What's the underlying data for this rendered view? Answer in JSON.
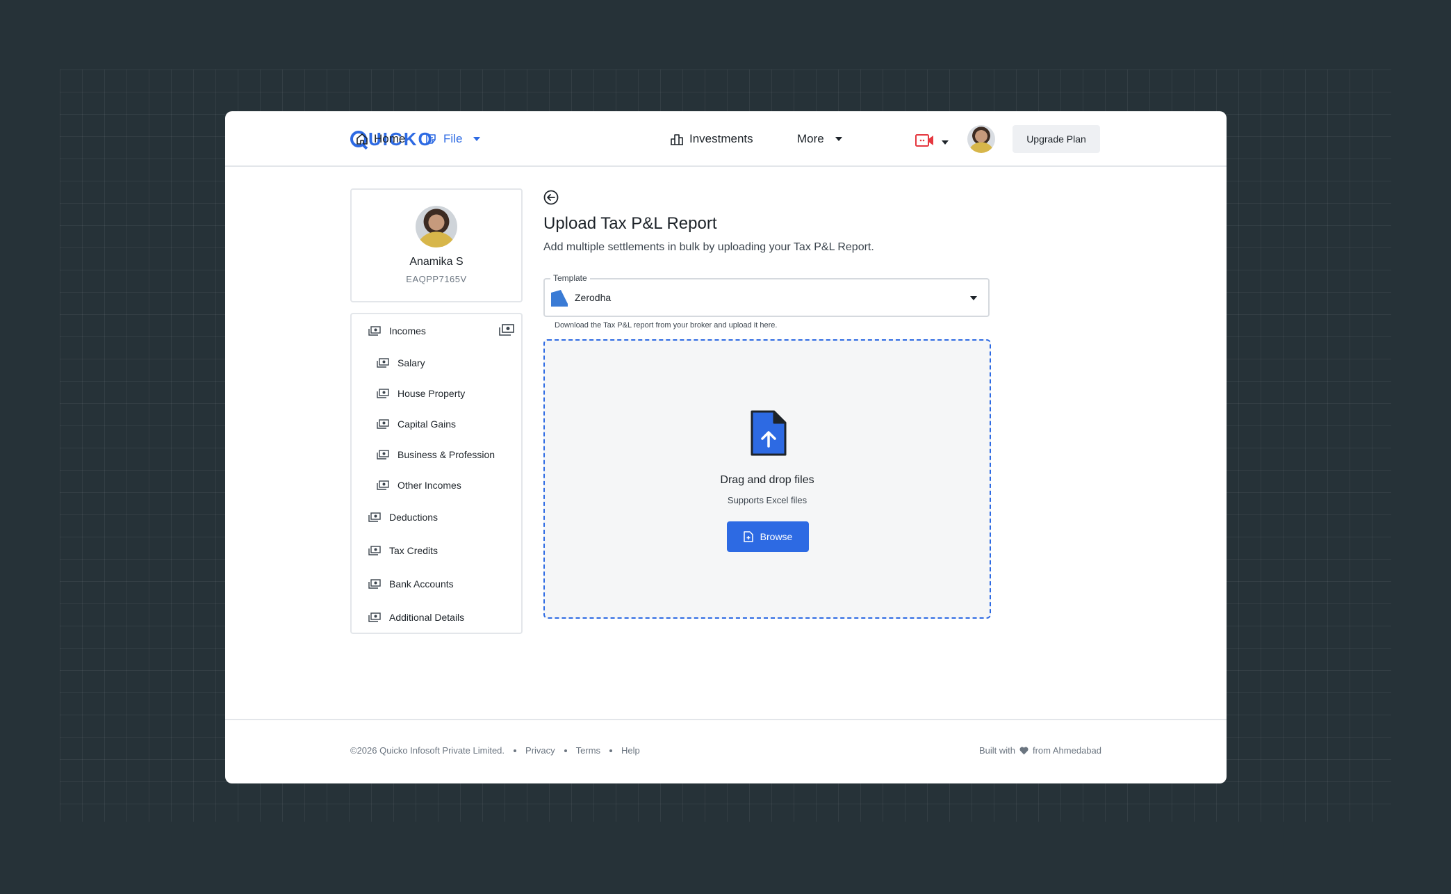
{
  "header": {
    "logo_text": "UICKO",
    "nav": [
      {
        "label": "Home",
        "icon": "home-icon"
      },
      {
        "label": "File",
        "icon": "file-icon",
        "active": true
      },
      {
        "label": "Investments",
        "icon": "investments-icon"
      },
      {
        "label": "More"
      }
    ],
    "upgrade_label": "Upgrade Plan",
    "video_icon": "video-icon",
    "accent_color": "#2d6ae3",
    "video_color": "#e5373f"
  },
  "profile": {
    "name": "Anamika S",
    "pan": "EAQPP7165V"
  },
  "sidebar": {
    "items": [
      {
        "label": "Incomes",
        "icon": "money-icon"
      },
      {
        "label": "Salary",
        "icon": "money-icon"
      },
      {
        "label": "House Property",
        "icon": "money-icon"
      },
      {
        "label": "Capital Gains",
        "icon": "money-icon"
      },
      {
        "label": "Business & Profession",
        "icon": "money-icon"
      },
      {
        "label": "Other Incomes",
        "icon": "money-icon"
      },
      {
        "label": "Deductions",
        "icon": "money-icon"
      },
      {
        "label": "Tax Credits",
        "icon": "money-icon"
      },
      {
        "label": "Bank Accounts",
        "icon": "money-icon"
      },
      {
        "label": "Additional Details",
        "icon": "money-icon"
      }
    ]
  },
  "main": {
    "title": "Upload Tax P&L Report",
    "subtitle": "Add multiple settlements in bulk by uploading your Tax P&L Report.",
    "template": {
      "label": "Template",
      "value": "Zerodha",
      "help": "Download the Tax P&L report from your broker and upload it here."
    },
    "dropzone": {
      "title": "Drag and drop files",
      "subtitle": "Supports Excel files",
      "browse_label": "Browse"
    }
  },
  "footer": {
    "copyright": "©2026 Quicko Infosoft Private Limited.",
    "links": [
      "Privacy",
      "Terms",
      "Help"
    ],
    "built_prefix": "Built with",
    "built_suffix": "from Ahmedabad"
  }
}
